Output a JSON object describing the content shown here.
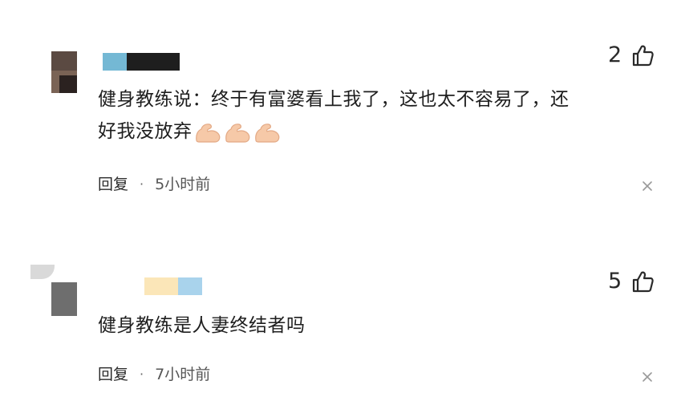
{
  "comments": [
    {
      "like_count": "2",
      "text_line1": "健身教练说：终于有富婆看上我了，这也太不容易了，还",
      "text_line2": "好我没放弃",
      "emoji": [
        "flexed-biceps",
        "flexed-biceps",
        "flexed-biceps"
      ],
      "reply_label": "回复",
      "separator": "·",
      "time": "5小时前"
    },
    {
      "like_count": "5",
      "text_line1": "健身教练是人妻终结者吗",
      "reply_label": "回复",
      "separator": "·",
      "time": "7小时前"
    }
  ],
  "icons": {
    "like": "thumbs-up-icon",
    "close": "close-icon",
    "emoji": "flexed-biceps-icon"
  },
  "colors": {
    "text": "#1e1e1e",
    "meta": "#555555",
    "icon": "#2a2a2a",
    "close": "#999999",
    "emoji_skin": "#f6c9a8"
  }
}
